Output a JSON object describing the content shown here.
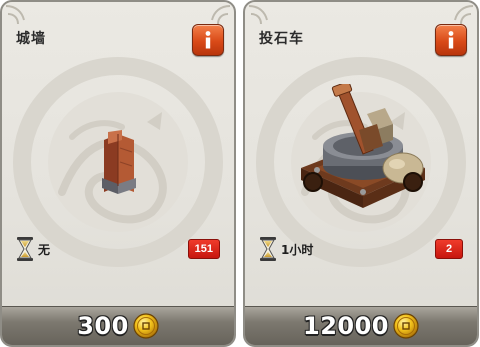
{
  "cards": [
    {
      "title": "城墙",
      "building_icon": "wall-building-icon",
      "info_label": "i",
      "time_icon": "hourglass-icon",
      "time": "无",
      "count": "151",
      "price": "300",
      "currency_icon": "gold-coin-icon"
    },
    {
      "title": "投石车",
      "building_icon": "catapult-building-icon",
      "info_label": "i",
      "time_icon": "hourglass-icon",
      "time": "1小时",
      "count": "2",
      "price": "12000",
      "currency_icon": "gold-coin-icon"
    }
  ],
  "colors": {
    "card_bg": "#e8e6e0",
    "info_button": "#d94a18",
    "count_badge": "#d2190f",
    "price_bar": "#7c786f",
    "coin_gold": "#f2c21b"
  }
}
